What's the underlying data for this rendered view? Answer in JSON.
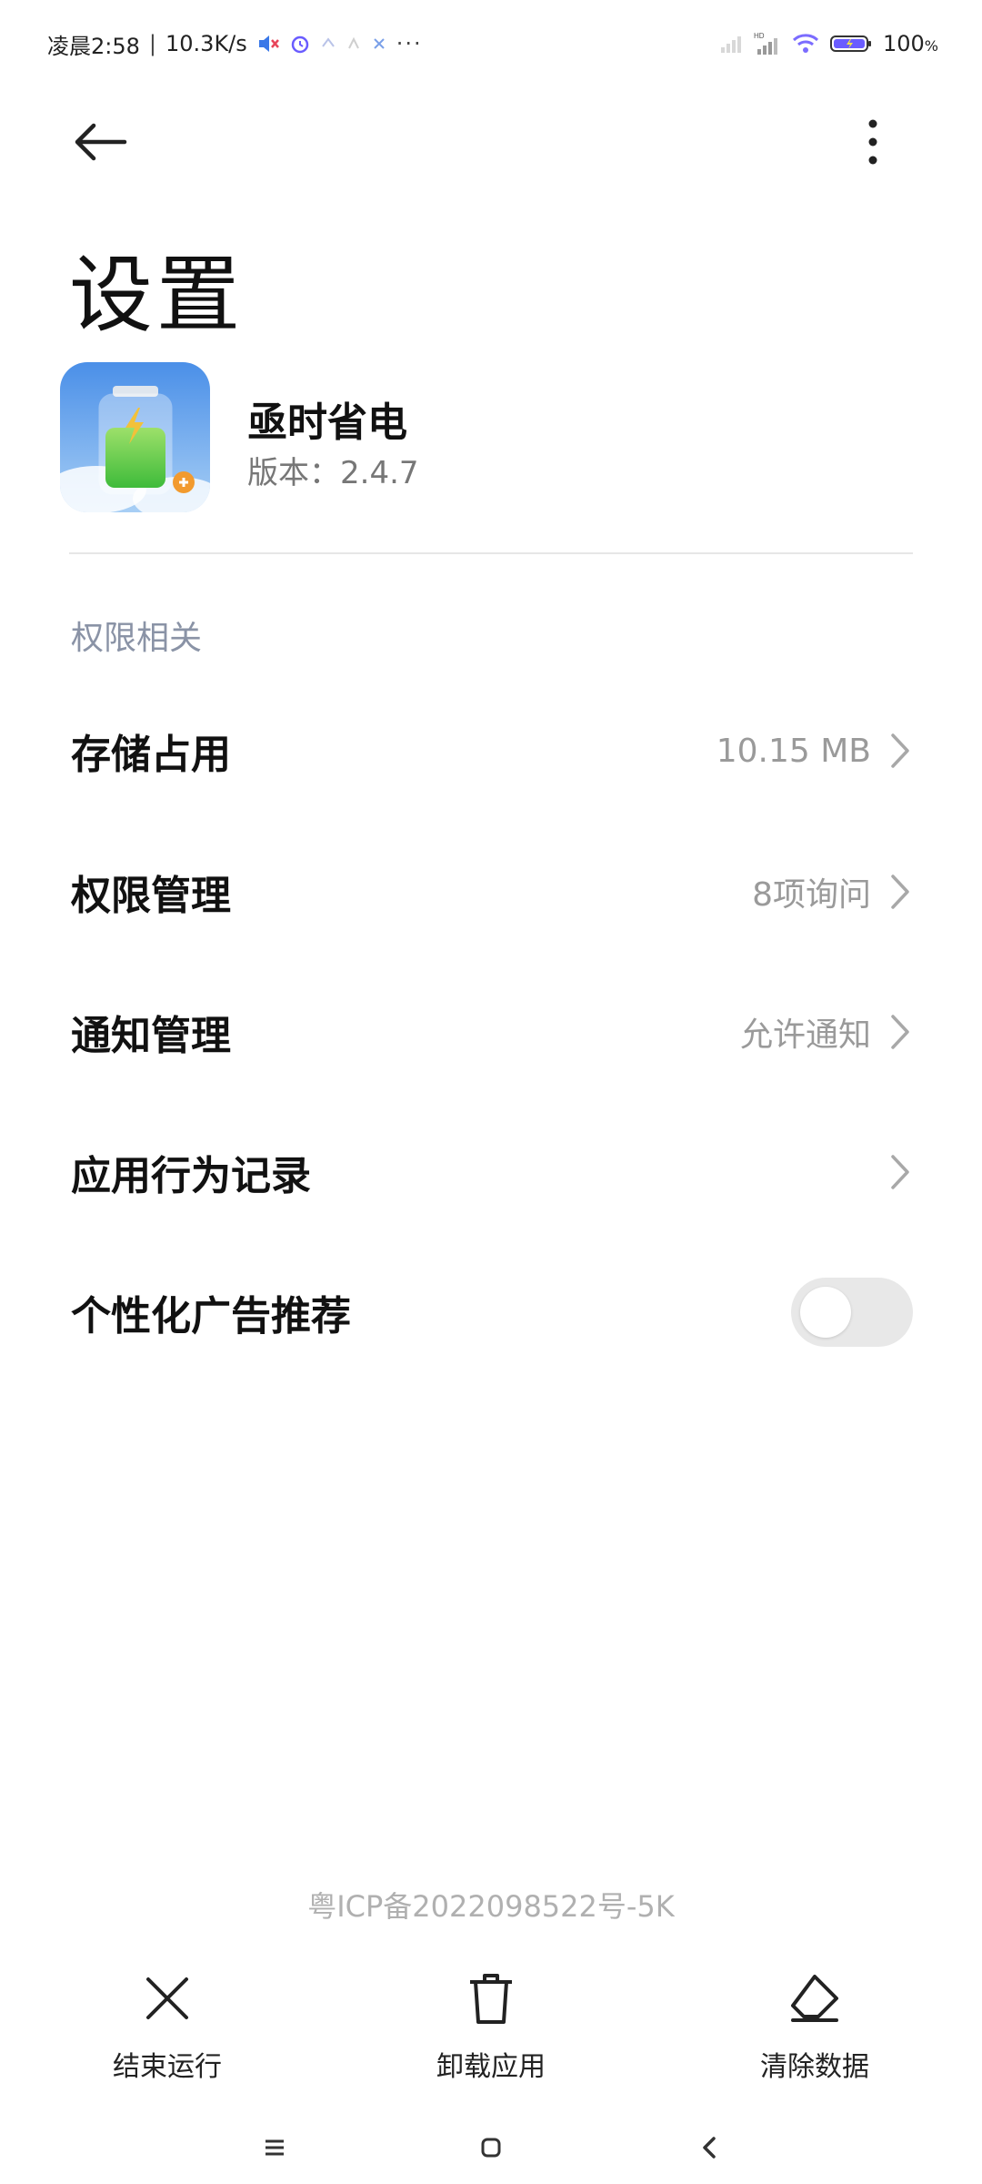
{
  "status_bar": {
    "time": "凌晨2:58",
    "network_speed": "10.3K/s",
    "battery": "100"
  },
  "header": {
    "title": "设置"
  },
  "app": {
    "name": "亟时省电",
    "version": "版本：2.4.7"
  },
  "section": {
    "title": "权限相关"
  },
  "rows": [
    {
      "label": "存储占用",
      "value": "10.15 MB"
    },
    {
      "label": "权限管理",
      "value": "8项询问"
    },
    {
      "label": "通知管理",
      "value": "允许通知"
    },
    {
      "label": "应用行为记录",
      "value": ""
    },
    {
      "label": "个性化广告推荐",
      "toggle": false
    }
  ],
  "footer": {
    "icp": "粤ICP备2022098522号-5K"
  },
  "actions": [
    {
      "label": "结束运行",
      "icon": "close-icon"
    },
    {
      "label": "卸载应用",
      "icon": "trash-icon"
    },
    {
      "label": "清除数据",
      "icon": "eraser-icon"
    }
  ],
  "colors": {
    "accent_text": "#8a93a6",
    "value_text": "#9a9a9a"
  }
}
